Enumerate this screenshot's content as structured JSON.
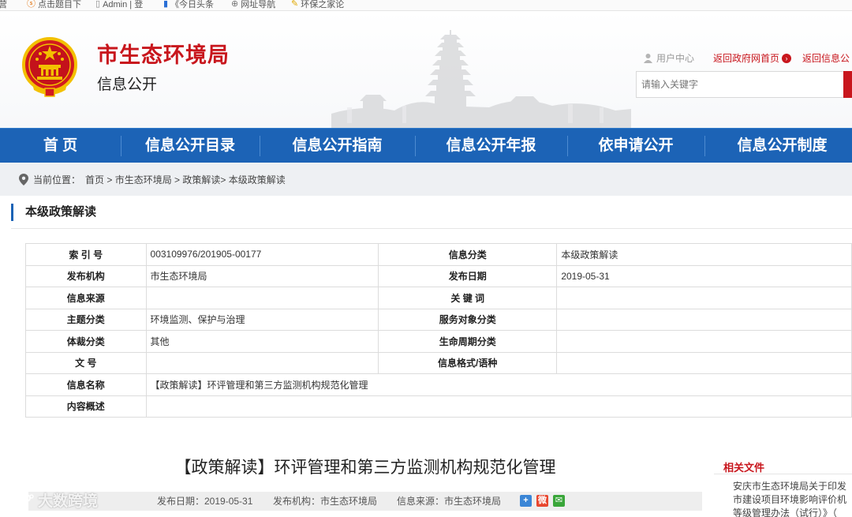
{
  "bookmarks": [
    {
      "icon": "partial-icon",
      "label": "营"
    },
    {
      "icon": "s-badge-icon",
      "label": "点击题目下"
    },
    {
      "icon": "page-icon",
      "label": "Admin | 登"
    },
    {
      "icon": "bar-chart-icon",
      "label": "《今日头条"
    },
    {
      "icon": "globe-icon",
      "label": "网址导航"
    },
    {
      "icon": "lightbulb-icon",
      "label": "环保之家论"
    }
  ],
  "header": {
    "title": "市生态环境局",
    "subtitle": "信息公开",
    "user_center": "用户中心",
    "back_gov": "返回政府网首页",
    "back_info": "返回信息公",
    "search_placeholder": "请输入关键字"
  },
  "nav": [
    "首 页",
    "信息公开目录",
    "信息公开指南",
    "信息公开年报",
    "依申请公开",
    "信息公开制度"
  ],
  "breadcrumb": {
    "prefix": "当前位置：",
    "path": "首页 > 市生态环境局 > 政策解读> 本级政策解读"
  },
  "section_title": "本级政策解读",
  "info_table": {
    "index_label": "索 引 号",
    "index_value": "003109976/201905-00177",
    "category_label": "信息分类",
    "category_value": "本级政策解读",
    "org_label": "发布机构",
    "org_value": "市生态环境局",
    "date_label": "发布日期",
    "date_value": "2019-05-31",
    "source_label": "信息来源",
    "source_value": "",
    "keyword_label": "关 键 词",
    "keyword_value": "",
    "topic_label": "主题分类",
    "topic_value": "环境监测、保护与治理",
    "service_label": "服务对象分类",
    "service_value": "",
    "genre_label": "体裁分类",
    "genre_value": "其他",
    "lifecycle_label": "生命周期分类",
    "lifecycle_value": "",
    "docno_label": "文 号",
    "docno_value": "",
    "format_label": "信息格式/语种",
    "format_value": "",
    "name_label": "信息名称",
    "name_value": "【政策解读】环评管理和第三方监测机构规范化管理",
    "summary_label": "内容概述",
    "summary_value": ""
  },
  "article": {
    "title": "【政策解读】环评管理和第三方监测机构规范化管理",
    "meta_date": "发布日期：2019-05-31",
    "meta_org": "发布机构：市生态环境局",
    "meta_source": "信息来源：市生态环境局"
  },
  "related": {
    "title": "相关文件",
    "lines": [
      "安庆市生态环境局关于印发",
      "市建设项目环境影响评价机",
      "等级管理办法（试行）》（"
    ]
  },
  "watermark": "大数跨境",
  "colors": {
    "brand_red": "#c8161d",
    "nav_blue": "#1c63b6"
  }
}
